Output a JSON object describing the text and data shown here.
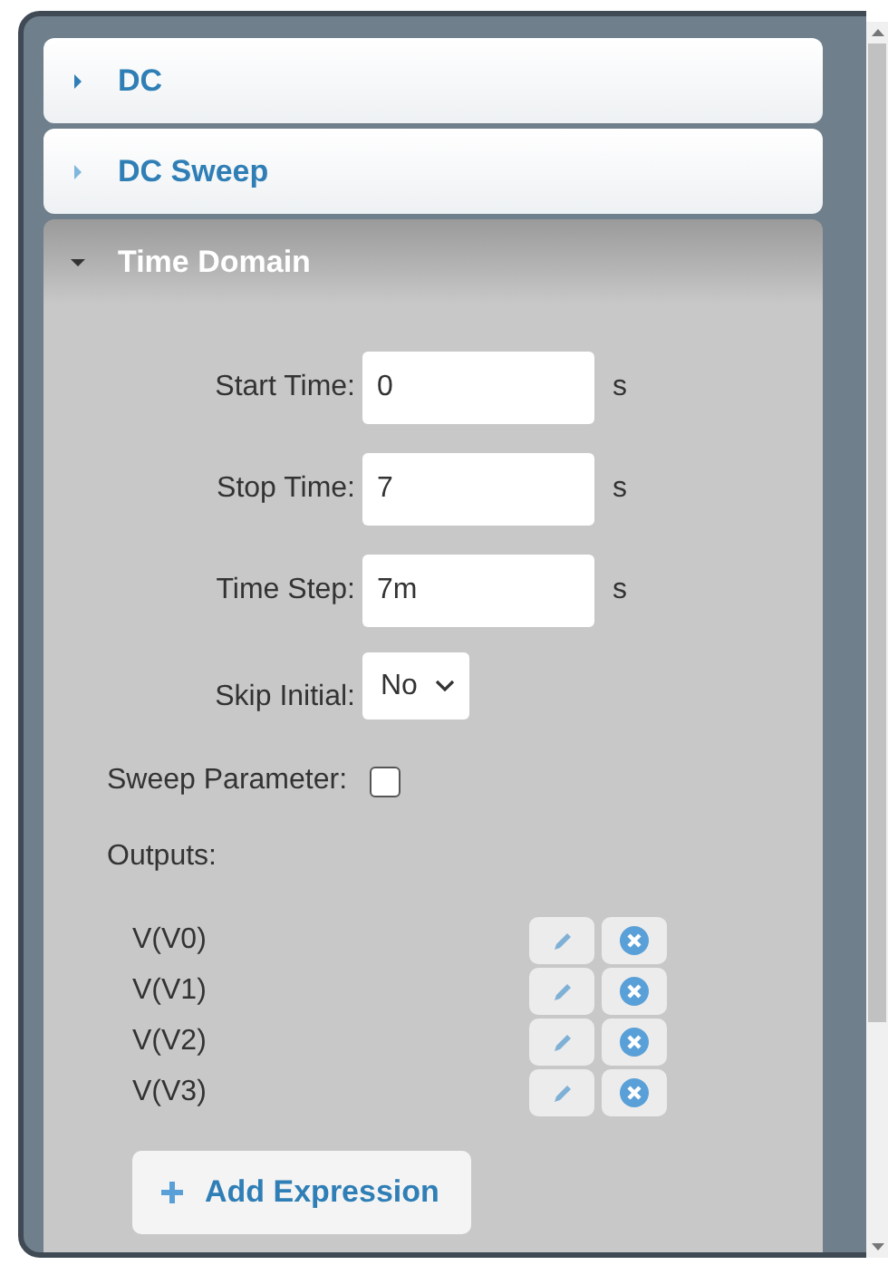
{
  "sections": [
    {
      "title": "DC",
      "expanded": false
    },
    {
      "title": "DC Sweep",
      "expanded": false
    },
    {
      "title": "Time Domain",
      "expanded": true
    }
  ],
  "time_domain": {
    "fields": [
      {
        "label": "Start Time:",
        "value": "0",
        "unit": "s"
      },
      {
        "label": "Stop Time:",
        "value": "7",
        "unit": "s"
      },
      {
        "label": "Time Step:",
        "value": "7m",
        "unit": "s"
      }
    ],
    "skip_initial": {
      "label": "Skip Initial:",
      "value": "No"
    },
    "sweep_parameter": {
      "label": "Sweep Parameter:",
      "checked": false
    },
    "outputs_label": "Outputs:",
    "outputs": [
      {
        "name": "V(V0)"
      },
      {
        "name": "V(V1)"
      },
      {
        "name": "V(V2)"
      },
      {
        "name": "V(V3)"
      }
    ],
    "add_button": "Add Expression"
  }
}
